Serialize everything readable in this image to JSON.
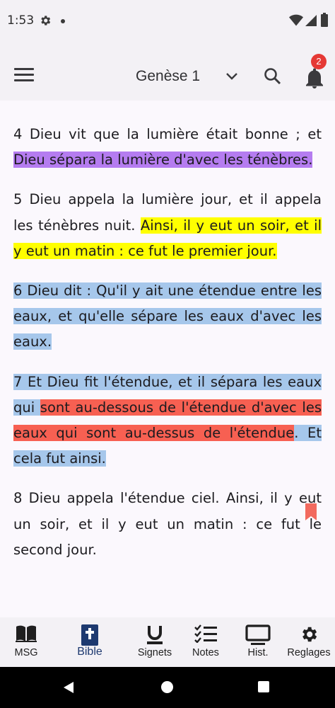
{
  "status_bar": {
    "time": "1:53"
  },
  "app_bar": {
    "title": "Genèse 1",
    "notification_count": "2"
  },
  "verses": [
    {
      "segments": [
        {
          "text": "4 Dieu vit que la lumière était bonne ; et ",
          "highlight": "none"
        },
        {
          "text": "Dieu sépara la lumière d'avec les ténèbres.",
          "highlight": "purple"
        }
      ]
    },
    {
      "segments": [
        {
          "text": "5 Dieu appela la lumière jour, et il appela les ténèbres nuit. ",
          "highlight": "none"
        },
        {
          "text": "Ainsi, il y eut un soir, et il y eut un matin : ce fut le premier jour.",
          "highlight": "yellow"
        }
      ]
    },
    {
      "segments": [
        {
          "text": "6 Dieu dit : Qu'il y ait une étendue entre les eaux, et qu'elle sépare les eaux d'avec les eaux.",
          "highlight": "blue"
        }
      ]
    },
    {
      "segments": [
        {
          "text": "7 Et Dieu fit l'étendue, et il sépara les eaux qui ",
          "highlight": "blue"
        },
        {
          "text": "sont au-dessous de l'étendue d'avec les eaux qui sont au-dessus de l'étendue",
          "highlight": "red"
        },
        {
          "text": ". Et cela fut ainsi.",
          "highlight": "blue"
        }
      ],
      "bookmarked": true
    },
    {
      "segments": [
        {
          "text": "8 Dieu appela l'étendue ciel. Ainsi, il y eut un soir, et il y eut un matin : ce fut le second jour.",
          "highlight": "none"
        }
      ]
    }
  ],
  "highlight_colors": {
    "purple": "#b57cf0",
    "yellow": "#ffff00",
    "blue": "#a6c7eb",
    "red": "#f76052"
  },
  "bottom_nav": {
    "items": [
      {
        "label": "MSG",
        "icon": "open-book-icon",
        "active": false
      },
      {
        "label": "Bible",
        "icon": "bible-cross-icon",
        "active": true
      },
      {
        "label": "Signets",
        "icon": "bookmark-u-icon",
        "active": false
      },
      {
        "label": "Notes",
        "icon": "checklist-icon",
        "active": false
      },
      {
        "label": "Hist.",
        "icon": "monitor-icon",
        "active": false
      },
      {
        "label": "Reglages",
        "icon": "gear-icon",
        "active": false
      }
    ]
  }
}
